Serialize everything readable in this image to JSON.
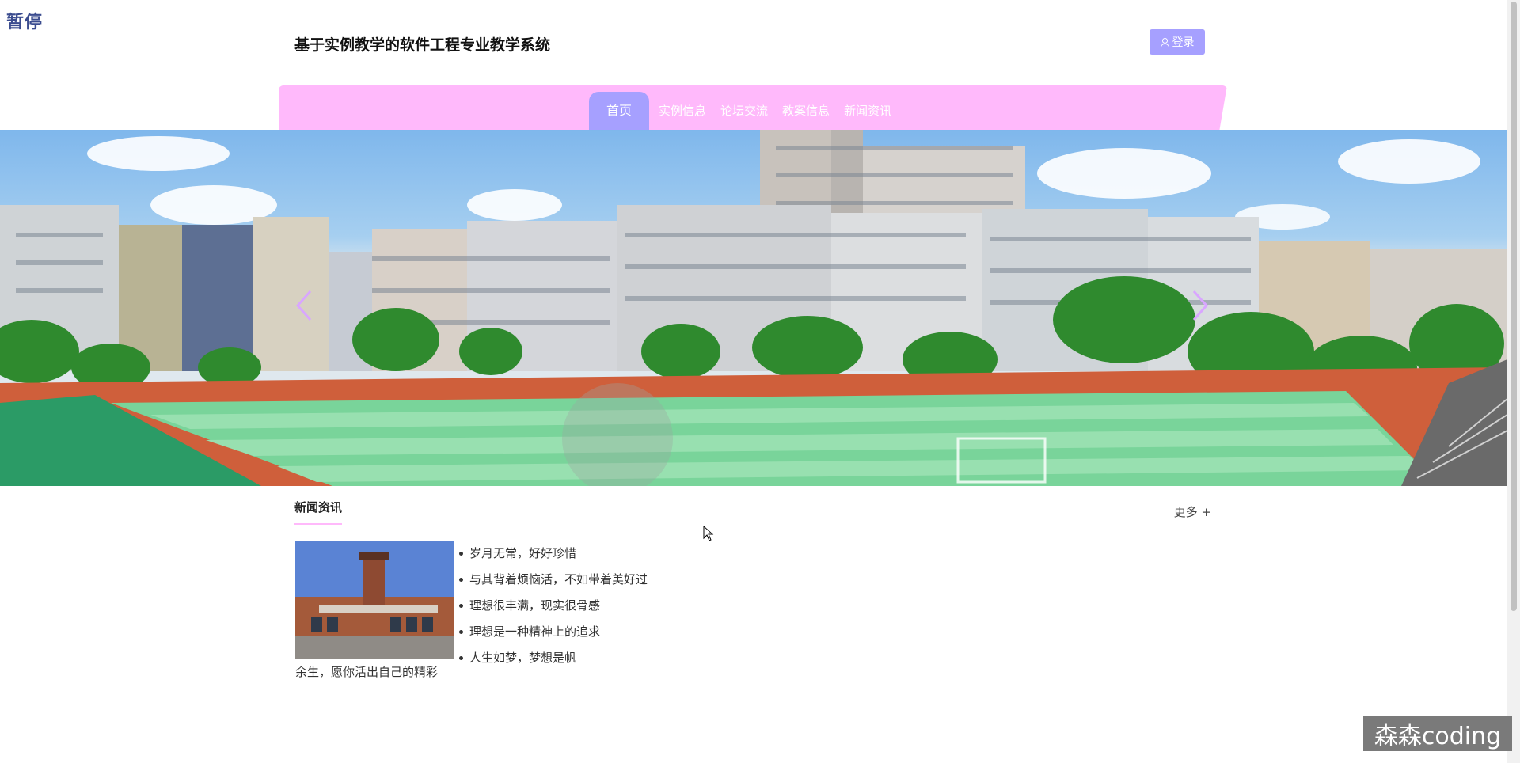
{
  "badge": {
    "text": "暂停"
  },
  "header": {
    "site_title": "基于实例教学的软件工程专业教学系统",
    "login_label": "登录",
    "login_icon": "user-icon"
  },
  "nav": {
    "items": [
      {
        "label": "首页",
        "active": true
      },
      {
        "label": "实例信息"
      },
      {
        "label": "论坛交流"
      },
      {
        "label": "教案信息"
      },
      {
        "label": "新闻资讯"
      }
    ]
  },
  "banner": {
    "prev_icon": "chevron-left-icon",
    "next_icon": "chevron-right-icon"
  },
  "news": {
    "title": "新闻资讯",
    "more_label": "更多 +",
    "items": [
      "岁月无常，好好珍惜",
      "与其背着烦恼活，不如带着美好过",
      "理想很丰满，现实很骨感",
      "理想是一种精神上的追求",
      "人生如梦，梦想是帆"
    ],
    "caption": "余生，愿你活出自己的精彩"
  },
  "watermark": {
    "text": "森森coding"
  },
  "colors": {
    "accent": "#a6a0ff",
    "nav_bg": "#ffb9fb",
    "pause_badge": "#3b4c8f"
  }
}
